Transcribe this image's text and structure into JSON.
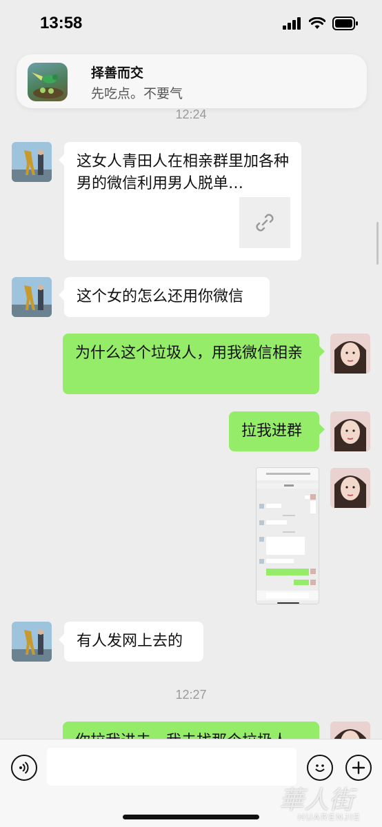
{
  "status_bar": {
    "time": "13:58"
  },
  "notification": {
    "title": "择善而交",
    "body": "先吃点。不要气"
  },
  "timestamps": [
    "12:24",
    "12:27"
  ],
  "messages": [
    {
      "side": "left",
      "type": "link",
      "text": "这女人青田人在相亲群里加各种男的微信利用男人脱单…",
      "icon": "link-icon"
    },
    {
      "side": "left",
      "type": "text",
      "text": "这个女的怎么还用你微信"
    },
    {
      "side": "right",
      "type": "text",
      "text": "为什么这个垃圾人，用我微信相亲"
    },
    {
      "side": "right",
      "type": "text",
      "text": "拉我进群"
    },
    {
      "side": "right",
      "type": "image"
    },
    {
      "side": "left",
      "type": "text",
      "text": "有人发网上去的"
    },
    {
      "side": "right",
      "type": "text",
      "text": "你拉我进去，我去找那个垃圾人"
    }
  ],
  "input_bar": {
    "voice_icon": "voice-icon",
    "emoji_icon": "emoji-icon",
    "plus_icon": "plus-icon"
  },
  "watermark": {
    "main": "華人街",
    "sub": "HUARENJIE"
  },
  "colors": {
    "background": "#ededed",
    "bubble_self": "#95ec69",
    "bubble_other": "#ffffff"
  }
}
